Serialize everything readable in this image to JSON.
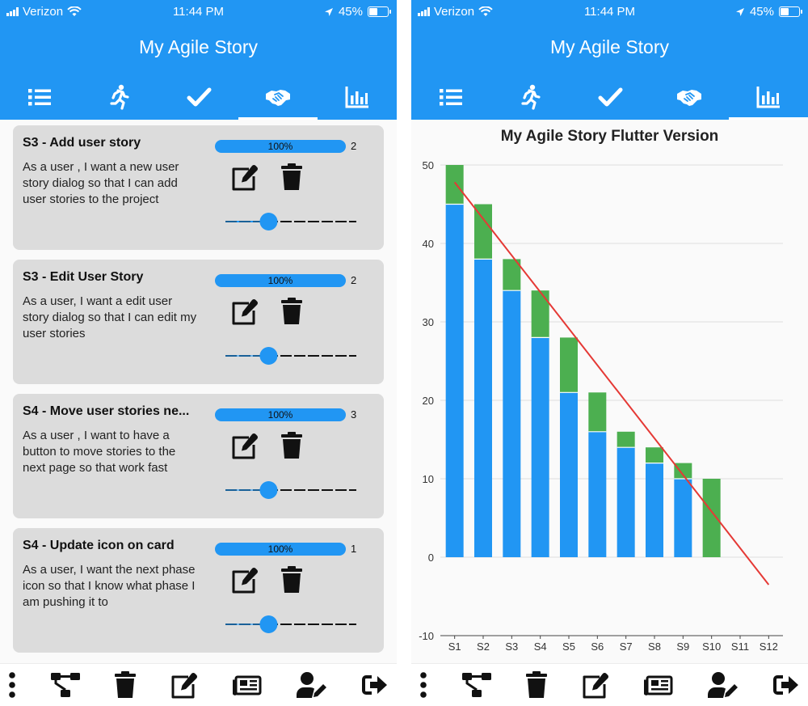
{
  "status": {
    "carrier": "Verizon",
    "time": "11:44 PM",
    "battery": "45%"
  },
  "app": {
    "title": "My Agile Story"
  },
  "tabs": [
    {
      "name": "tab-backlog",
      "icon": "list-icon"
    },
    {
      "name": "tab-in-progress",
      "icon": "running-icon"
    },
    {
      "name": "tab-done",
      "icon": "check-icon"
    },
    {
      "name": "tab-accepted",
      "icon": "handshake-icon"
    },
    {
      "name": "tab-chart",
      "icon": "bar-chart-icon"
    }
  ],
  "left_active_tab": "tab-accepted",
  "right_active_tab": "tab-chart",
  "stories": [
    {
      "title": "S3 - Add user story",
      "description": "As a user , I want a new user story dialog so that I can add user stories to the project",
      "progress": "100%",
      "progress_value": 100,
      "points": "2",
      "slider_value": 0.33
    },
    {
      "title": "S3 - Edit User Story",
      "description": "As a user, I want a edit user story dialog so that I can edit my user stories",
      "progress": "100%",
      "progress_value": 100,
      "points": "2",
      "slider_value": 0.33
    },
    {
      "title": "S4 - Move user stories ne...",
      "description": "As a user , I want to have a button to move stories to the next page so that work fast",
      "progress": "100%",
      "progress_value": 100,
      "points": "3",
      "slider_value": 0.33
    },
    {
      "title": "S4 - Update icon on card",
      "description": "As a user, I want the next phase icon so that I know what phase I am pushing it to",
      "progress": "100%",
      "progress_value": 100,
      "points": "1",
      "slider_value": 0.33
    }
  ],
  "bottom_actions": [
    {
      "name": "more-button",
      "icon": "more-vertical-icon"
    },
    {
      "name": "workflow-button",
      "icon": "sitemap-icon"
    },
    {
      "name": "delete-all-button",
      "icon": "trash-icon"
    },
    {
      "name": "edit-project-button",
      "icon": "edit-icon"
    },
    {
      "name": "news-button",
      "icon": "newspaper-icon"
    },
    {
      "name": "edit-user-button",
      "icon": "user-edit-icon"
    },
    {
      "name": "logout-button",
      "icon": "sign-out-icon"
    }
  ],
  "colors": {
    "primary": "#2196f3",
    "remaining": "#2196f3",
    "completed": "#4caf50",
    "ideal": "#e53935",
    "card": "#dcdcdc"
  },
  "chart_data": {
    "type": "bar",
    "title": "My Agile Story Flutter Version",
    "categories": [
      "S1",
      "S2",
      "S3",
      "S4",
      "S5",
      "S6",
      "S7",
      "S8",
      "S9",
      "S10",
      "S11",
      "S12"
    ],
    "series": [
      {
        "values": [
          45,
          38,
          34,
          28,
          21,
          16,
          14,
          12,
          10,
          0,
          0,
          0
        ],
        "color": "#2196f3"
      },
      {
        "values": [
          5,
          7,
          4,
          6,
          7,
          5,
          2,
          2,
          2,
          10,
          0,
          0
        ],
        "color": "#4caf50"
      }
    ],
    "stacked": true,
    "trend_line": {
      "from": [
        1,
        47.8
      ],
      "to": [
        12,
        -3.5
      ],
      "color": "#e53935"
    },
    "ylim": [
      -10,
      50
    ],
    "yticks": [
      -10,
      0,
      10,
      20,
      30,
      40,
      50
    ],
    "xlabel": "",
    "ylabel": "",
    "grid": true
  }
}
